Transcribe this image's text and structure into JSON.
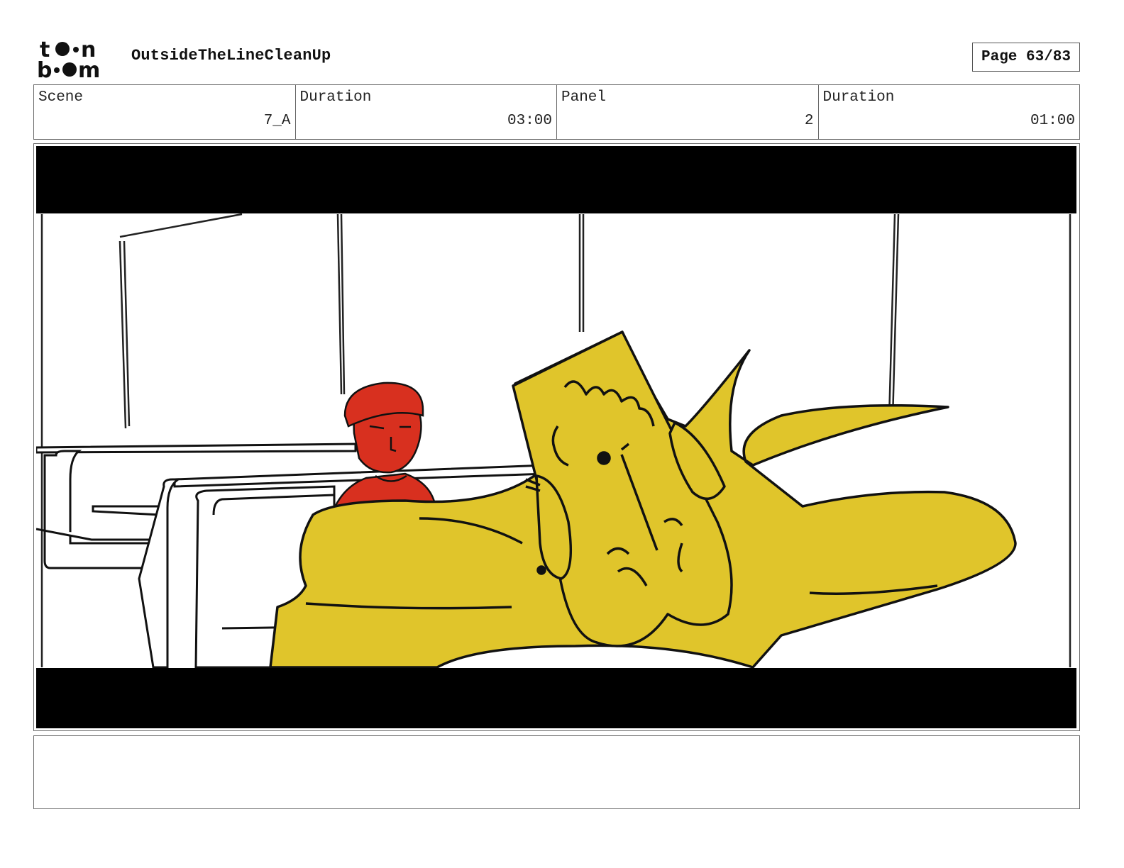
{
  "header": {
    "logo_text": "toon boom",
    "project_title": "OutsideTheLineCleanUp",
    "page_label": "Page 63/83"
  },
  "info": {
    "scene_label": "Scene",
    "scene_value": "7_A",
    "scene_duration_label": "Duration",
    "scene_duration_value": "03:00",
    "panel_label": "Panel",
    "panel_value": "2",
    "panel_duration_label": "Duration",
    "panel_duration_value": "01:00"
  },
  "colors": {
    "letterbox": "#000000",
    "character_yellow": "#E0C52B",
    "character_red": "#D8301F",
    "line": "#111111"
  },
  "notes": {
    "text": ""
  }
}
